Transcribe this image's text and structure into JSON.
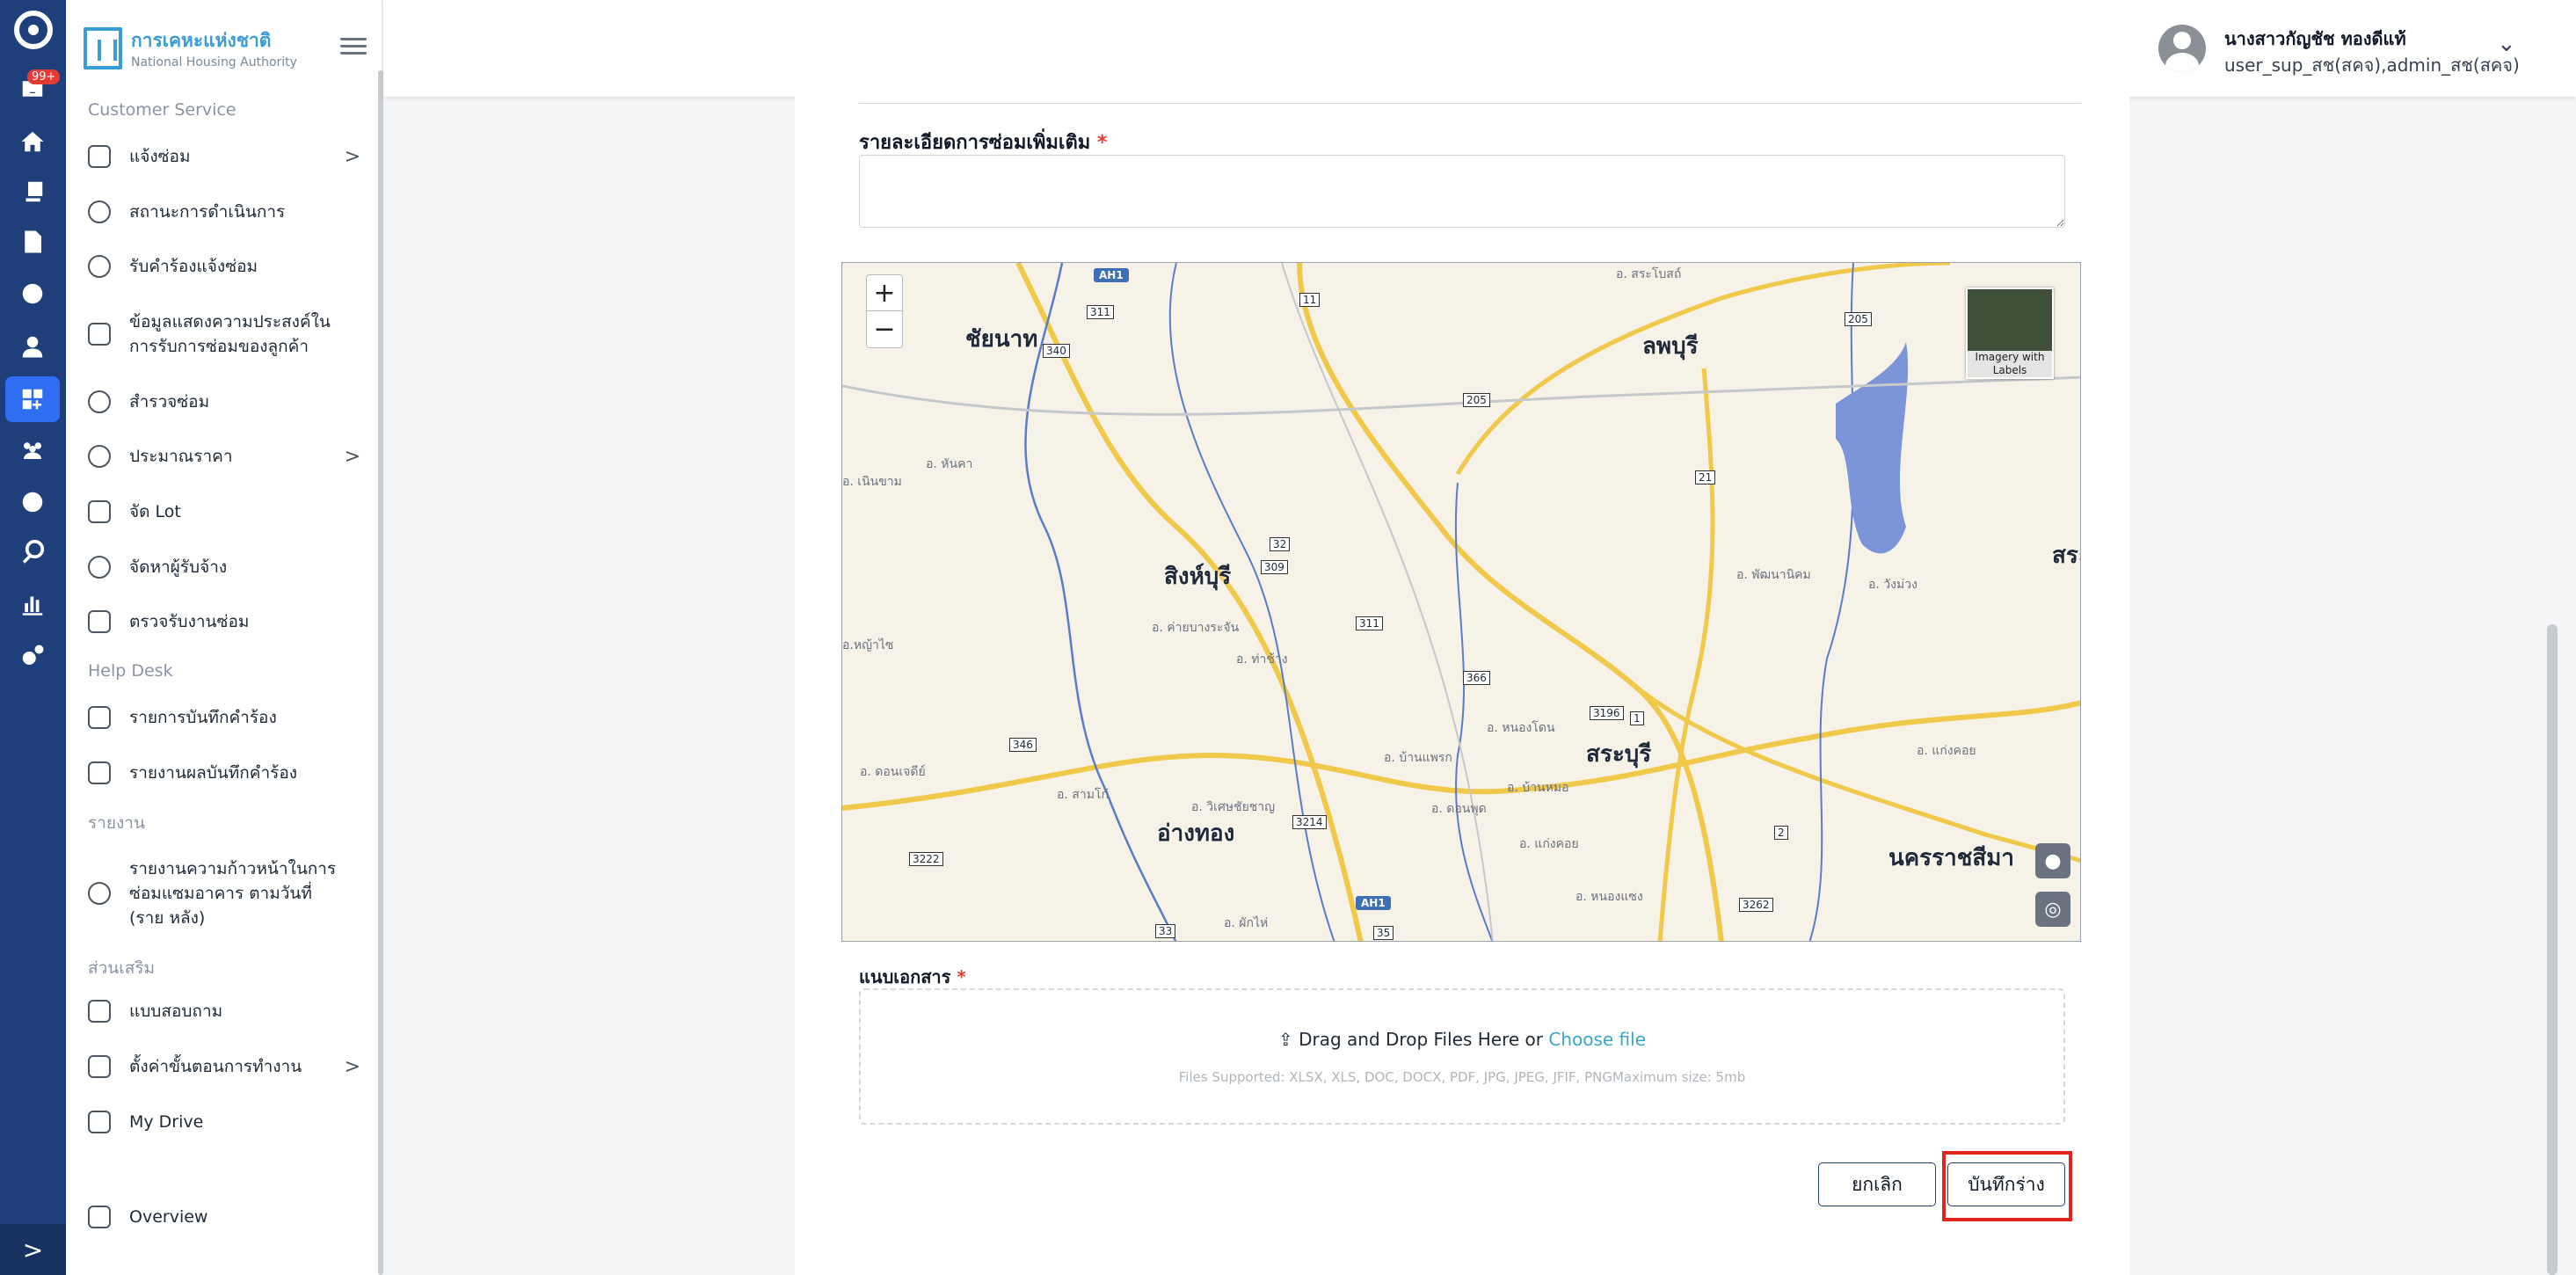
{
  "rail": {
    "badge": "99+",
    "icons": [
      "inbox-icon",
      "home-icon",
      "copy-icon",
      "document-icon",
      "settings-icon",
      "user-icon",
      "dashboard-icon",
      "team-icon",
      "gear-icon",
      "search-icon",
      "chart-icon",
      "cogs-icon"
    ],
    "active_icon": "dashboard-icon",
    "expand_label": ">"
  },
  "sidebar": {
    "brand_th": "การเคหะแห่งชาติ",
    "brand_en": "National Housing Authority",
    "sections": {
      "customer_service": "Customer Service",
      "help_desk": "Help Desk",
      "reports": "รายงาน",
      "extras": "ส่วนเสริม"
    },
    "items": [
      {
        "label": "แจ้งซ่อม",
        "icon": "wrench-icon",
        "chevron": ">"
      },
      {
        "label": "สถานะการดำเนินการ",
        "icon": "history-icon"
      },
      {
        "label": "รับคำร้องแจ้งซ่อม",
        "icon": "headset-icon"
      },
      {
        "label": "ข้อมูลแสดงความประสงค์ใน การรับการซ่อมของลูกค้า",
        "icon": "file-icon"
      },
      {
        "label": "สำรวจซ่อม",
        "icon": "search-icon"
      },
      {
        "label": "ประมาณราคา",
        "icon": "coin-icon",
        "chevron": ">"
      },
      {
        "label": "จัด Lot",
        "icon": "layers-icon"
      },
      {
        "label": "จัดหาผู้รับจ้าง",
        "icon": "helmet-icon"
      },
      {
        "label": "ตรวจรับงานซ่อม",
        "icon": "file-check-icon"
      },
      {
        "label": "รายการบันทึกคำร้อง",
        "icon": "edit-icon"
      },
      {
        "label": "รายงานผลบันทึกคำร้อง",
        "icon": "file-text-icon"
      },
      {
        "label": "รายงานความก้าวหน้าในการ ซ่อมแซมอาคาร ตามวันที่ (ราย หลัง)",
        "icon": "database-icon"
      },
      {
        "label": "แบบสอบถาม",
        "icon": "clipboard-icon"
      },
      {
        "label": "ตั้งค่าขั้นตอนการทำงาน",
        "icon": "stairs-icon",
        "chevron": ">"
      },
      {
        "label": "My Drive",
        "icon": "folder-icon"
      },
      {
        "label": "Overview",
        "icon": "grid-icon"
      }
    ]
  },
  "header": {
    "user_name": "นางสาวกัญชัช ทองดีแท้",
    "user_role": "user_sup_สช(สคจ),admin_สช(สคจ)"
  },
  "form": {
    "details_label": "รายละเอียดการซ่อมเพิ่มเติม",
    "details_value": "",
    "required_mark": "*",
    "attachment_label": "แนบเอกสาร",
    "drop_text": "Drag and Drop Files Here or",
    "choose_file": "Choose file",
    "supported": "Files Supported: XLSX, XLS, DOC, DOCX, PDF, JPG, JPEG, JFIF, PNGMaximum size: 5mb",
    "cancel_button": "ยกเลิก",
    "save_draft_button": "บันทึกร่าง"
  },
  "map": {
    "zoom_in": "+",
    "zoom_out": "−",
    "imagery_label": "Imagery with Labels",
    "places": {
      "chainat": "ชัยนาท",
      "lopburi": "ลพบุรี",
      "singburi": "สิงห์บุรี",
      "saraburi": "สระบุรี",
      "angthong": "อ่างทอง",
      "nakhonratchasima": "นครราชสีมา",
      "sara": "สระ"
    },
    "small_places": {
      "a1": "อ. สระโบสถ์",
      "a2": "อ. หันคา",
      "a3": "อ. ค่ายบางระจัน",
      "a4": "อ. ท่าช้าง",
      "a5": "อ. พัฒนานิคม",
      "a6": "อ. วังม่วง",
      "a7": "อ. หนองโดน",
      "a8": "อ. บ้านหมอ",
      "a9": "อ. ดอนพุด",
      "a10": "อ. วิเศษชัยชาญ",
      "a11": "อ. สามโก้",
      "a12": "อ. ดอนเจดีย์",
      "a13": "อ. แก่งคอย",
      "a14": "อ. หนองแซง",
      "a15": "อ. ผักไห่",
      "a16": "อ. เนินขาม",
      "a17": "อ.หญ้าไซ",
      "a18": "อ. บ้านแพรก",
      "a19": "อ. แก่งคอย"
    },
    "shields": {
      "ah1_top": "AH1",
      "ah1_bottom": "AH1"
    },
    "routes": {
      "r11": "11",
      "r311": "311",
      "r340": "340",
      "r205a": "205",
      "r205b": "205",
      "r21": "21",
      "r32": "32",
      "r309": "309",
      "r311b": "311",
      "r366": "366",
      "r3196": "3196",
      "r1": "1",
      "r346": "346",
      "r3214": "3214",
      "r2": "2",
      "r3222": "3222",
      "r3262": "3262",
      "r33": "33",
      "r35": "35"
    }
  }
}
